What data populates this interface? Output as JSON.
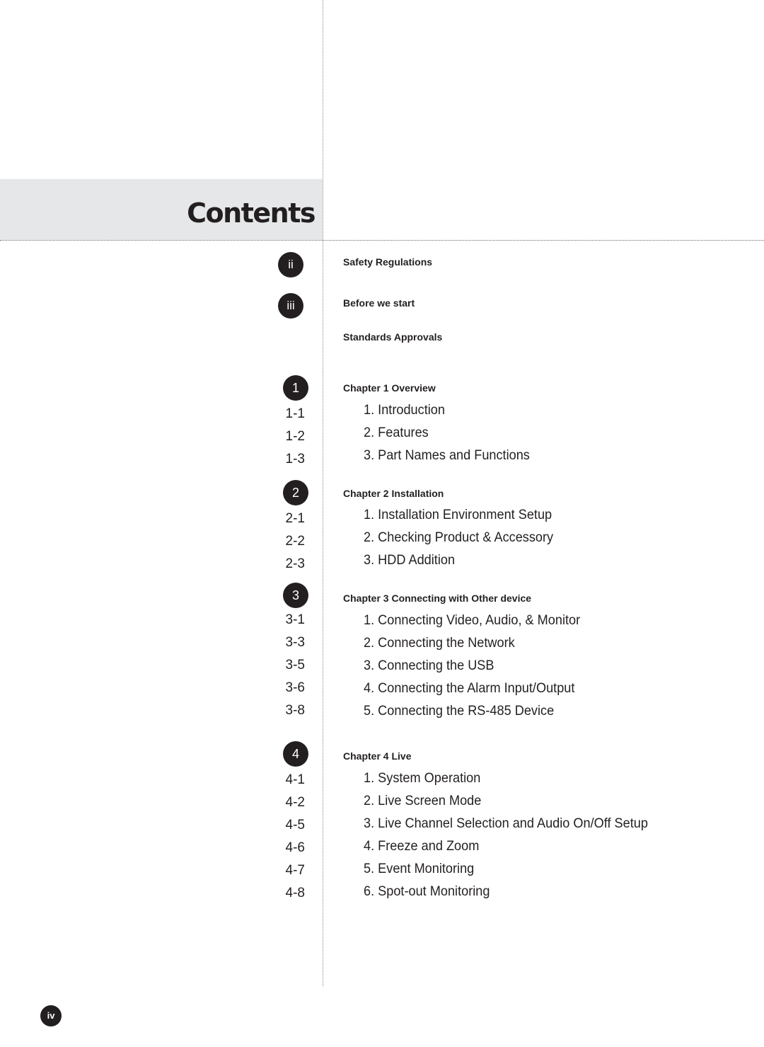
{
  "page_title": "Contents",
  "front_matter": [
    {
      "badge": "ii",
      "title": "Safety Regulations"
    },
    {
      "badge": "iii",
      "title": "Before we start"
    },
    {
      "badge": "",
      "title": "Standards Approvals"
    }
  ],
  "chapters": [
    {
      "badge": "1",
      "title": "Chapter 1 Overview",
      "entries": [
        {
          "page": "1-1",
          "label": "1. Introduction"
        },
        {
          "page": "1-2",
          "label": "2. Features"
        },
        {
          "page": "1-3",
          "label": "3. Part Names and Functions"
        }
      ]
    },
    {
      "badge": "2",
      "title": "Chapter 2 Installation",
      "entries": [
        {
          "page": "2-1",
          "label": "1. Installation Environment Setup"
        },
        {
          "page": "2-2",
          "label": "2. Checking Product & Accessory"
        },
        {
          "page": "2-3",
          "label": "3. HDD Addition"
        }
      ]
    },
    {
      "badge": "3",
      "title": "Chapter 3 Connecting with Other device",
      "entries": [
        {
          "page": "3-1",
          "label": "1. Connecting Video, Audio, & Monitor"
        },
        {
          "page": "3-3",
          "label": "2. Connecting the Network"
        },
        {
          "page": "3-5",
          "label": "3. Connecting the USB"
        },
        {
          "page": "3-6",
          "label": "4. Connecting the Alarm Input/Output"
        },
        {
          "page": "3-8",
          "label": "5. Connecting the RS-485 Device"
        }
      ]
    },
    {
      "badge": "4",
      "title": "Chapter 4 Live",
      "entries": [
        {
          "page": "4-1",
          "label": "1. System Operation"
        },
        {
          "page": "4-2",
          "label": "2. Live Screen Mode"
        },
        {
          "page": "4-5",
          "label": "3. Live Channel Selection and Audio On/Off Setup"
        },
        {
          "page": "4-6",
          "label": "4. Freeze and Zoom"
        },
        {
          "page": "4-7",
          "label": "5. Event Monitoring"
        },
        {
          "page": "4-8",
          "label": "6. Spot-out Monitoring"
        }
      ]
    }
  ],
  "footer": {
    "page_number": "iv"
  },
  "colors": {
    "ink": "#231f20",
    "band": "#e6e7e8"
  }
}
